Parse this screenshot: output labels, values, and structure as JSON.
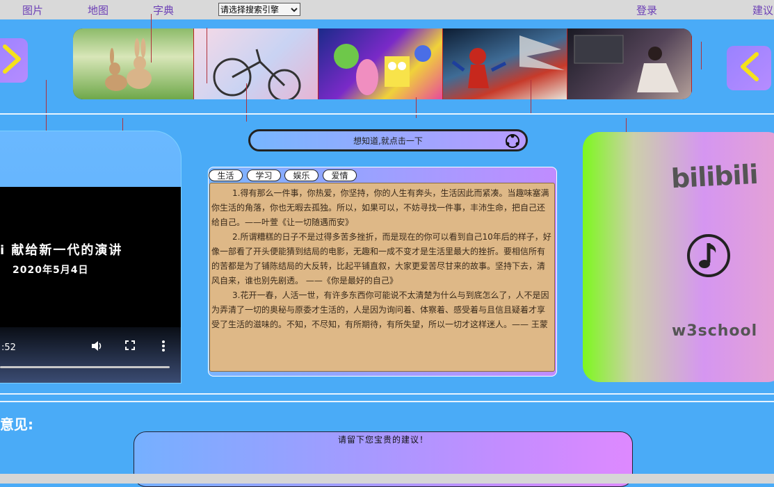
{
  "nav": {
    "links": [
      "图片",
      "地图",
      "字典"
    ],
    "engine_select": "请选择搜索引擎",
    "login": "登录",
    "suggest": "建议"
  },
  "banner": {
    "images": [
      "rabbits-photo",
      "bicycle-photo",
      "spongebob-photo",
      "spiderman-photo",
      "girl-room-photo"
    ]
  },
  "video": {
    "title": "i 献给新一代的演讲",
    "date": "2020年5月4日",
    "time": ":52"
  },
  "search_pill": {
    "text": "想知道,就点击一下"
  },
  "tabs": [
    "生活",
    "学习",
    "娱乐",
    "爱情"
  ],
  "content": {
    "paragraphs": [
      "1.得有那么一件事，你热爱，你坚持，你的人生有奔头，生活因此而紧凑。当趣味塞满你生活的角落，你也无暇去孤独。所以，如果可以，不妨寻找一件事，丰沛生命，把自己还给自己。——叶萱《让一切随遇而安》",
      "2.所谓糟糕的日子不是过得多苦多挫折，而是现在的你可以看到自己10年后的样子，好像一部看了开头便能猜到结局的电影，无趣和一成不变才是生活里最大的挫折。要相信所有的苦都是为了铺陈结局的大反转，比起平铺直叙，大家更爱苦尽甘来的故事。坚持下去，清风自来，谁也别先剧透。 ——《你是最好的自己》",
      "3.花开一春，人活一世，有许多东西你可能说不太清楚为什么与到底怎么了，人不是因为弄清了一切的奥秘与原委才生活的，人是因为询问着、体察着、感受着与且信且疑着才享受了生活的滋味的。不知，不尽知，有所期待，有所失望，所以一切才这样迷人。—— 王蒙"
    ]
  },
  "side_card": {
    "logo": "bilibili",
    "caption": "w3school"
  },
  "feedback": {
    "label": "意见:",
    "placeholder": "请留下您宝贵的建议！"
  },
  "colors": {
    "page_bg": "#4aabf7",
    "content_bg": "#deb887",
    "link": "#6c3fb5",
    "arrow": "#f5e21a"
  }
}
